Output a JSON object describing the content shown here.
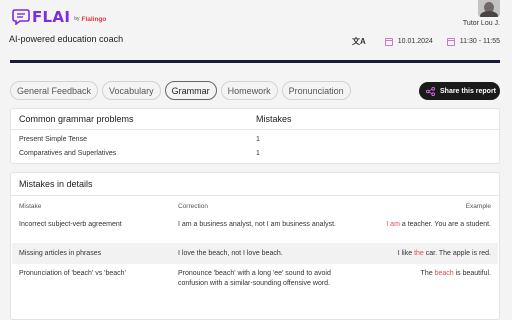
{
  "header": {
    "logo_text": "FLAI",
    "logo_by": "by",
    "logo_brand": "Flalingo",
    "subtitle": "AI-powered education coach",
    "tutor_name": "Tutor Lou J.",
    "date": "10.01.2024",
    "time": "11:30 - 11:55",
    "translate_icon": "translate-icon",
    "calendar_icon": "calendar-icon",
    "clock_icon": "calendar-icon"
  },
  "tabs": [
    {
      "label": "General Feedback",
      "active": false
    },
    {
      "label": "Vocabulary",
      "active": false
    },
    {
      "label": "Grammar",
      "active": true
    },
    {
      "label": "Homework",
      "active": false
    },
    {
      "label": "Pronunciation",
      "active": false
    }
  ],
  "share": {
    "label": "Share this report",
    "icon": "share-icon"
  },
  "problems": {
    "title": "Common grammar problems",
    "mistakes_header": "Mistakes",
    "rows": [
      {
        "name": "Present Simple Tense",
        "count": "1"
      },
      {
        "name": "Comparatives and Superlatives",
        "count": "1"
      }
    ]
  },
  "details": {
    "title": "Mistakes in details",
    "headers": {
      "mistake": "Mistake",
      "correction": "Correction",
      "example": "Example"
    },
    "rows": [
      {
        "mistake": "Incorrect subject-verb agreement",
        "correction": "I am a business analyst, not I am business analyst.",
        "example_pre": "",
        "example_hl": "I am",
        "example_post": " a teacher. You are a student."
      },
      {
        "mistake": "Missing articles in phrases",
        "correction": "I love the beach, not I love beach.",
        "example_pre": "I like ",
        "example_hl": "the",
        "example_post": " car. The apple is red."
      },
      {
        "mistake": "Pronunciation of 'beach' vs 'beach'",
        "correction": "Pronounce 'beach' with a long 'ee' sound to avoid confusion with a similar-sounding offensive word.",
        "example_pre": "The ",
        "example_hl": "beach",
        "example_post": " is beautiful."
      }
    ]
  },
  "colors": {
    "brand": "#7a2fd8",
    "highlight": "#e04848",
    "rule": "#1a1a3a"
  }
}
